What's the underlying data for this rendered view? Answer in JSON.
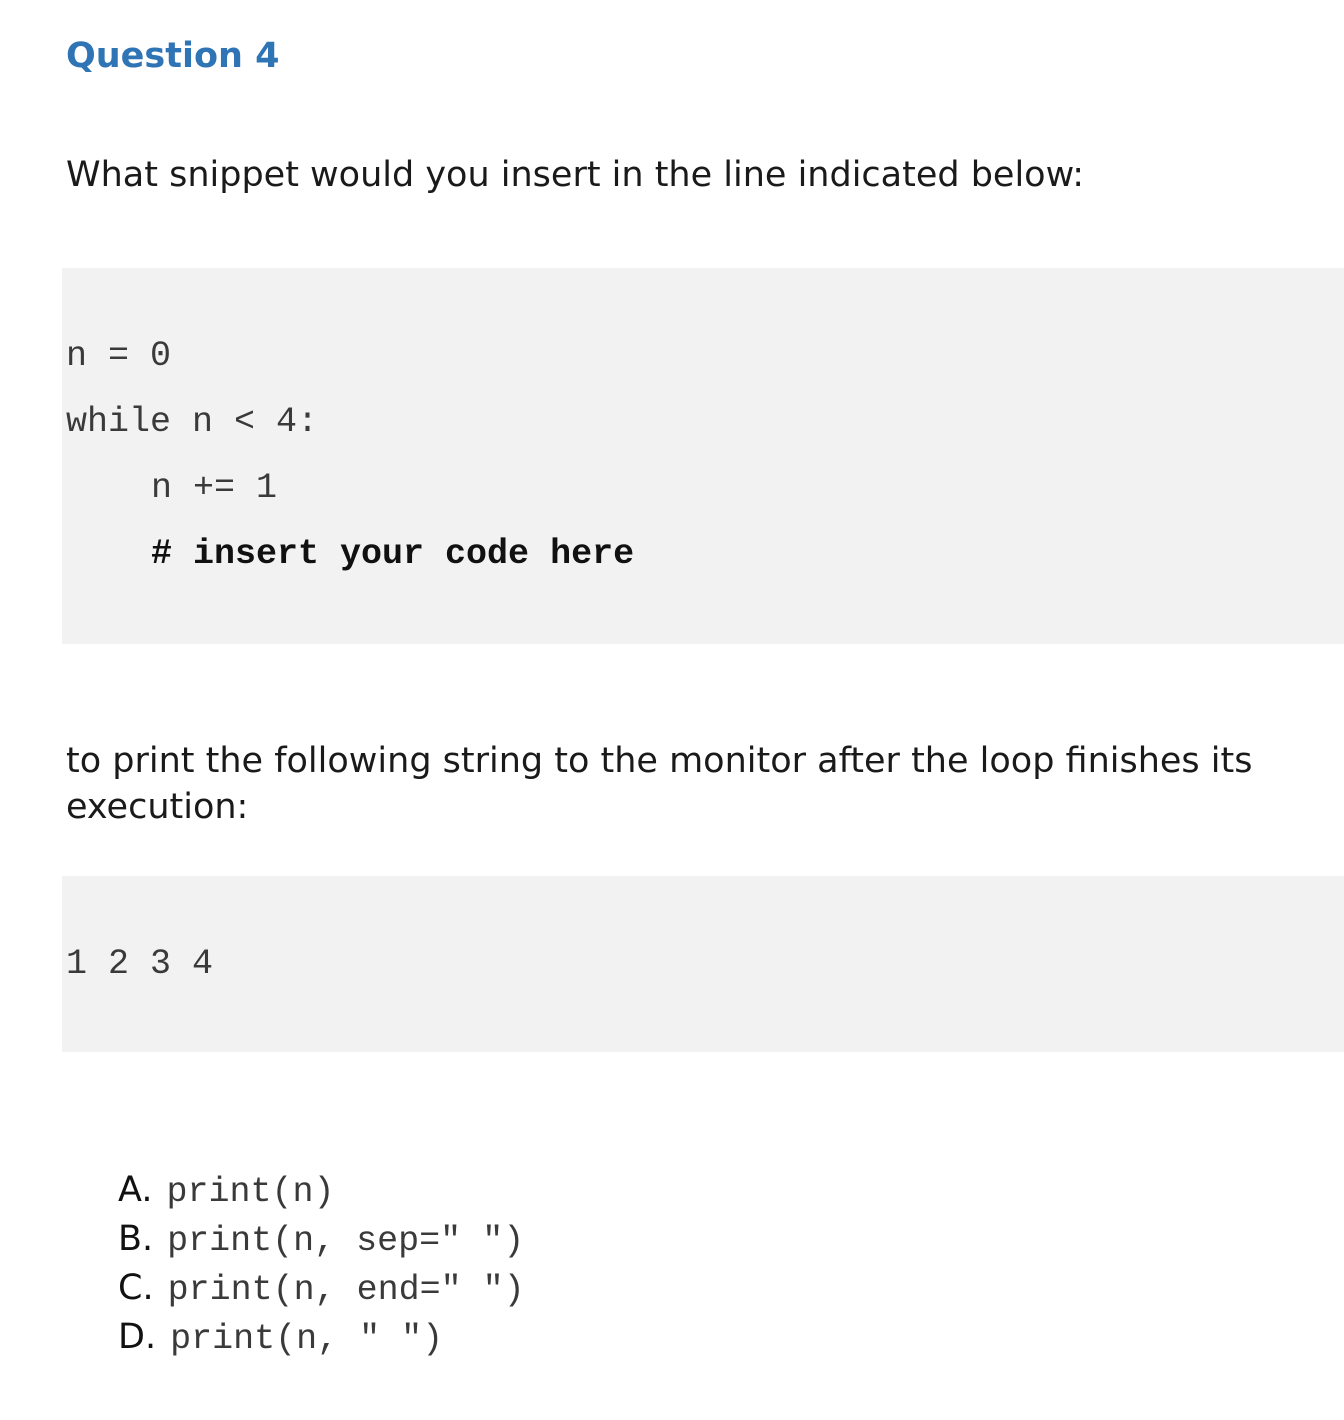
{
  "title": "Question 4",
  "prompt": "What snippet would you insert in the line indicated below:",
  "code": {
    "line1": "n = 0",
    "line2": "while n < 4:",
    "line3": "n += 1",
    "line4": "# insert your code here"
  },
  "followup": "to print the following string to the monitor after the loop finishes its execution:",
  "output": "1 2 3 4",
  "answers": [
    {
      "letter": "A.",
      "code": "print(n)"
    },
    {
      "letter": "B.",
      "code": "print(n, sep=\" \")"
    },
    {
      "letter": "C.",
      "code": "print(n, end=\" \")"
    },
    {
      "letter": "D.",
      "code": "print(n, \" \")"
    }
  ]
}
